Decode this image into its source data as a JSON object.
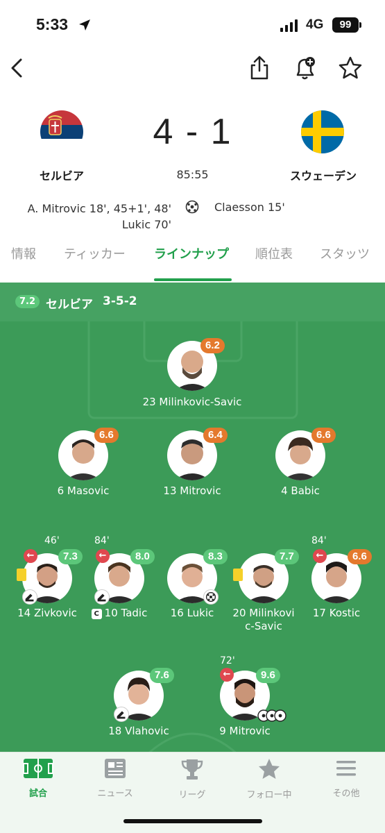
{
  "status": {
    "time": "5:33",
    "network": "4G",
    "battery": "99"
  },
  "match": {
    "home": {
      "name": "セルビア",
      "flag_colors": [
        "#c6363c",
        "#0c4076",
        "#ffffff"
      ]
    },
    "away": {
      "name": "スウェーデン",
      "flag_colors": [
        "#006aa7",
        "#fecc00"
      ]
    },
    "score": "4 - 1",
    "clock": "85:55",
    "home_scorers": [
      "A.  Mitrovic 18', 45+1', 48'",
      "Lukic 70'"
    ],
    "away_scorers": [
      "Claesson 15'"
    ]
  },
  "tabs": [
    {
      "label": "情報",
      "active": false
    },
    {
      "label": "ティッカー",
      "active": false
    },
    {
      "label": "ラインナップ",
      "active": true
    },
    {
      "label": "順位表",
      "active": false
    },
    {
      "label": "スタッツ",
      "active": false
    }
  ],
  "lineup": {
    "team_rating": "7.2",
    "team": "セルビア",
    "formation": "3-5-2",
    "players": [
      {
        "num_name": "23 Milinkovic-Savic",
        "rating": "6.2",
        "color": "orange"
      },
      {
        "num_name": "6 Masovic",
        "rating": "6.6",
        "color": "orange"
      },
      {
        "num_name": "13 Mitrovic",
        "rating": "6.4",
        "color": "orange"
      },
      {
        "num_name": "4 Babic",
        "rating": "6.6",
        "color": "orange"
      },
      {
        "num_name": "14 Zivkovic",
        "rating": "7.3",
        "color": "green",
        "sub_minute": "46'"
      },
      {
        "num_name": "10 Tadic",
        "rating": "8.0",
        "color": "green",
        "sub_minute": "84'",
        "captain": "C"
      },
      {
        "num_name": "16 Lukic",
        "rating": "8.3",
        "color": "green"
      },
      {
        "name_line1": "20 Milinkovi",
        "name_line2": "c-Savic",
        "rating": "7.7",
        "color": "green"
      },
      {
        "num_name": "17 Kostic",
        "rating": "6.6",
        "color": "orange",
        "sub_minute": "84'"
      },
      {
        "num_name": "18 Vlahovic",
        "rating": "7.6",
        "color": "green"
      },
      {
        "num_name": "9 Mitrovic",
        "rating": "9.6",
        "color": "green",
        "sub_minute": "72'"
      }
    ]
  },
  "bottom_nav": [
    {
      "label": "試合",
      "icon": "pitch-icon",
      "active": true
    },
    {
      "label": "ニュース",
      "icon": "news-icon",
      "active": false
    },
    {
      "label": "リーグ",
      "icon": "trophy-icon",
      "active": false
    },
    {
      "label": "フォロー中",
      "icon": "star-icon",
      "active": false
    },
    {
      "label": "その他",
      "icon": "menu-icon",
      "active": false
    }
  ]
}
